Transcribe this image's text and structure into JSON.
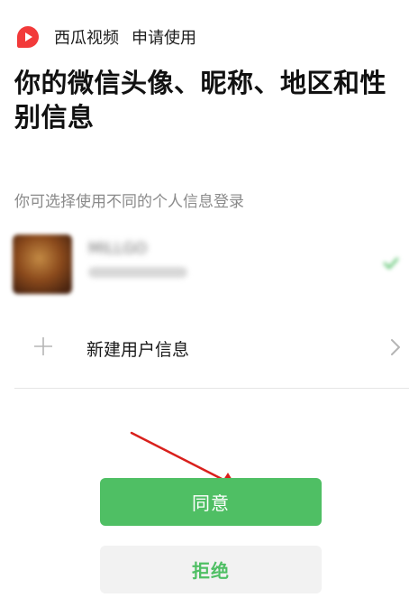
{
  "header": {
    "app_icon": "xigua-video-logo-icon",
    "app_name": "西瓜视频",
    "request_text": "申请使用"
  },
  "title": "你的微信头像、昵称、地区和性别信息",
  "subtitle": "你可选择使用不同的个人信息登录",
  "account": {
    "nickname": "MILLGO",
    "selected": true,
    "check_icon": "check-icon",
    "avatar_icon": "avatar"
  },
  "new_user": {
    "label": "新建用户信息",
    "plus_icon": "plus-icon",
    "chevron_icon": "chevron-right-icon"
  },
  "buttons": {
    "agree_label": "同意",
    "reject_label": "拒绝"
  },
  "colors": {
    "accent_green": "#4fbf64",
    "reject_bg": "#f2f2f2",
    "annotation_red": "#d9201c",
    "logo_red": "#f23a3a"
  }
}
